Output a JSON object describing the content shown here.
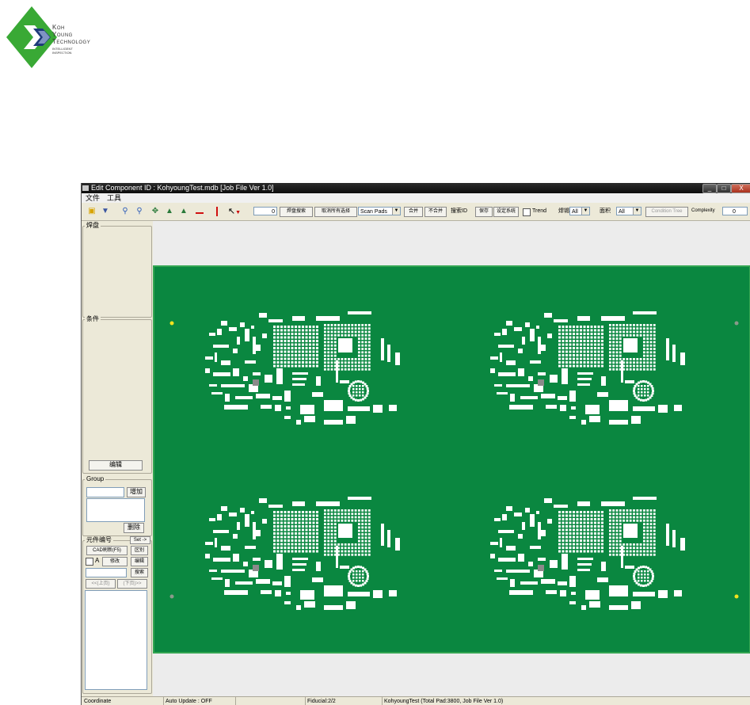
{
  "logo": {
    "line1": "Koh",
    "line2": "Young",
    "line3": "Technology",
    "line4": "Intelligent",
    "line5": "Inspection",
    "colors": {
      "diamond": "#39a935",
      "chevron_dark": "#1e3b7a",
      "chevron_light": "#7f93c3"
    }
  },
  "window": {
    "title": "Edit Component ID : KohyoungTest.mdb [Job File Ver 1.0]",
    "controls": {
      "minimize": "_",
      "maximize": "□",
      "close": "X"
    }
  },
  "menu": [
    "文件",
    "工具"
  ],
  "toolbar": {
    "icons": [
      "open-folder-icon",
      "import-icon",
      "zoom-in-icon",
      "zoom-out-icon",
      "pan-icon",
      "rotate-left-icon",
      "rotate-right-icon",
      "red-bar-icon",
      "red-pin-icon",
      "pointer-icon"
    ],
    "number_value": "0",
    "btn_search": "焊盘搜索",
    "btn_cancel_select": "取消所有选择",
    "pads_select": "Scan Pads",
    "btn_merge": "合并",
    "btn_split": "不合并",
    "lbl_search_id": "搜索ID",
    "btn_save": "保存",
    "btn_setup": "设定系统",
    "trend_label": "Trend",
    "lbl_combo1": "焊锡",
    "combo1_value": "All",
    "lbl_combo2": "面积",
    "combo2_value": "All",
    "btn_condition_tree": "Condition Tree",
    "lbl_complexity": "Complexity",
    "complexity_value": "0"
  },
  "left_panel": {
    "group_pad_title": "焊盘",
    "group_condition_title": "条件",
    "btn_edit": "编辑",
    "group_group_title": "Group",
    "btn_add": "增加",
    "btn_delete": "删除",
    "group_component_title": "元件编号",
    "btn_set": "Set ->",
    "btn_cad_refresh": "CAD刷新(F5)",
    "btn_distinguish": "区别",
    "chk_a_label": "A",
    "btn_modify": "修改",
    "btn_edit2": "编辑",
    "btn_search2": "搜索",
    "btn_prev": "<<(上页)",
    "btn_next": "(下页)>>"
  },
  "status": {
    "coordinate": "Coordinate",
    "auto_update": "Auto Update : OFF",
    "blank": "",
    "fiducial": "Fiducial:2/2",
    "info": "KohyoungTest (Total Pad:3800, Job File Ver 1.0)"
  },
  "colors": {
    "pcb_green": "#0a8740",
    "pad_white": "#ffffff",
    "fiducial_yellow": "#f2e21e",
    "fiducial_gray": "#8a9a8a"
  }
}
